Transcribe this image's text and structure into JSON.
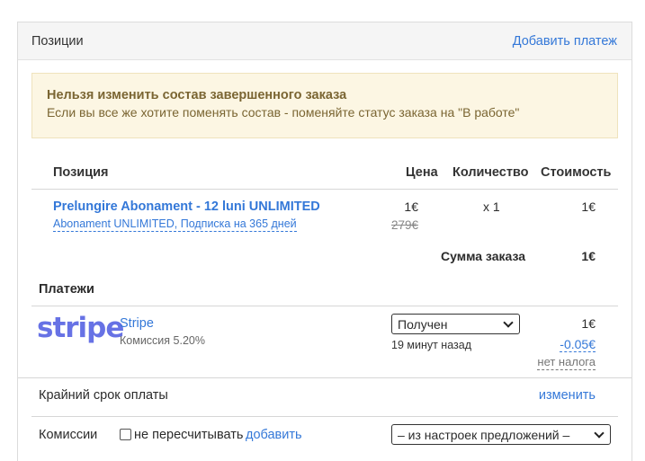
{
  "header": {
    "title": "Позиции",
    "add_payment_link": "Добавить платеж"
  },
  "warning": {
    "title": "Нельзя изменить состав завершенного заказа",
    "text": "Если вы все же хотите поменять состав - поменяйте статус заказа на \"В работе\""
  },
  "table": {
    "columns": [
      "Позиция",
      "Цена",
      "Количество",
      "Стоимость"
    ],
    "rows": [
      {
        "name": "Prelungire Abonament - 12 luni UNLIMITED",
        "subtitle": "Abonament UNLIMITED, Подписка на 365 дней",
        "price": "1€",
        "old_price": "279€",
        "quantity": "x 1",
        "cost": "1€"
      }
    ],
    "sum_label": "Сумма заказа",
    "sum_value": "1€"
  },
  "payments": {
    "title": "Платежи",
    "items": [
      {
        "logo_text": "stripe",
        "name": "Stripe",
        "fee": "Комиссия 5.20%",
        "status": "Получен",
        "time": "19 минут назад",
        "amount": "1€",
        "fee_amount": "-0.05€",
        "tax": "нет налога"
      }
    ]
  },
  "deadline": {
    "label": "Крайний срок оплаты",
    "change_link": "изменить"
  },
  "fees": {
    "label": "Комиссии",
    "checkbox_label": "не пересчитывать",
    "add_link": "добавить",
    "select_value": "– из настроек предложений –"
  },
  "colors": {
    "link": "#3478d8",
    "stripe": "#6772e5",
    "warning_bg": "#fcf6e3",
    "warning_text": "#7a6532"
  }
}
